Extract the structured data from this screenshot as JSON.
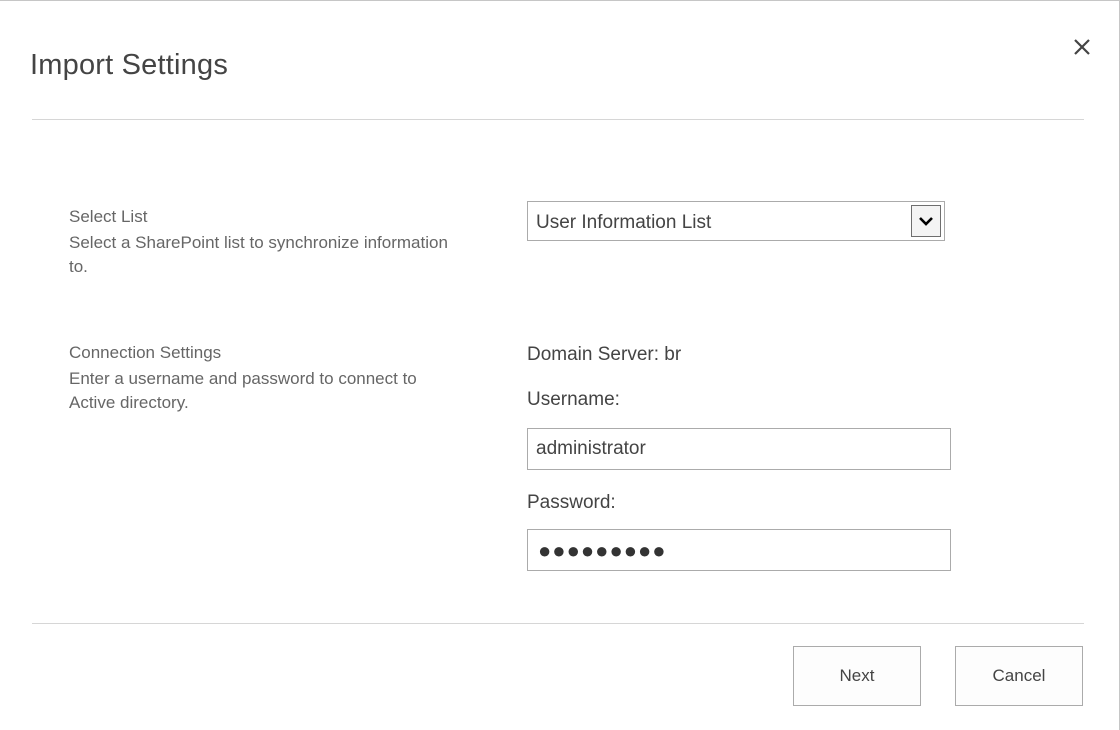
{
  "dialog": {
    "title": "Import Settings",
    "close_icon": "close-icon"
  },
  "select_list": {
    "title": "Select List",
    "description": "Select a SharePoint list to synchronize information to.",
    "selected_value": "User Information List",
    "arrow_icon": "chevron-down-icon"
  },
  "connection": {
    "title": "Connection Settings",
    "description": "Enter a username and password to connect to Active directory.",
    "domain_server": "Domain Server: br",
    "username_label": "Username:",
    "username_value": "administrator",
    "password_label": "Password:",
    "password_masked": "●●●●●●●●●"
  },
  "footer": {
    "next_label": "Next",
    "cancel_label": "Cancel"
  }
}
